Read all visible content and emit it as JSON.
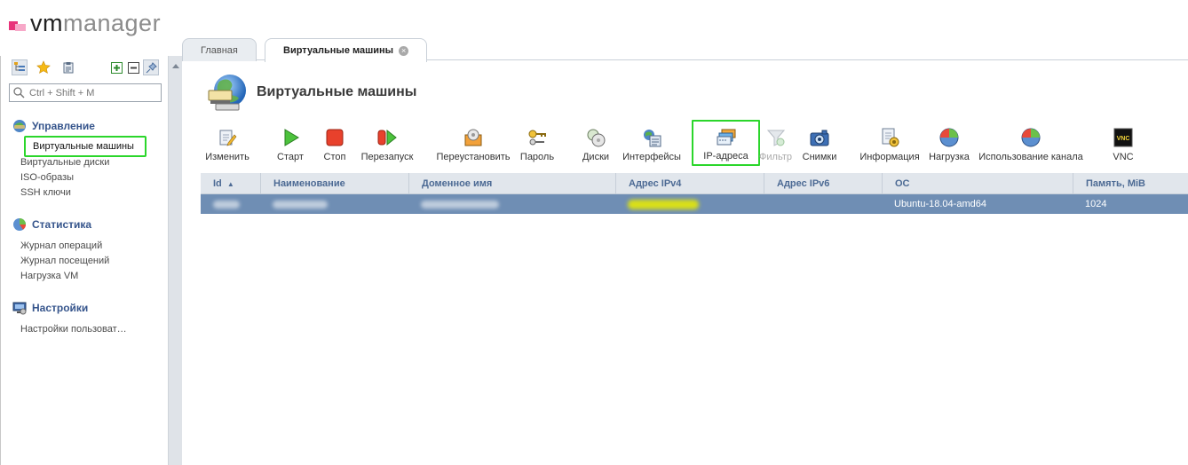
{
  "logo": {
    "part1": "vm",
    "part2": "manager"
  },
  "search": {
    "placeholder": "Ctrl + Shift + M"
  },
  "sidebar": {
    "sections": [
      {
        "title": "Управление",
        "icon": "management-icon",
        "items": [
          "Виртуальные машины",
          "Виртуальные диски",
          "ISO-образы",
          "SSH ключи"
        ]
      },
      {
        "title": "Статистика",
        "icon": "statistics-icon",
        "items": [
          "Журнал операций",
          "Журнал посещений",
          "Нагрузка VM"
        ]
      },
      {
        "title": "Настройки",
        "icon": "settings-icon",
        "items": [
          "Настройки пользоват…"
        ]
      }
    ]
  },
  "tabs": [
    {
      "label": "Главная",
      "active": false
    },
    {
      "label": "Виртуальные машины",
      "active": true
    }
  ],
  "page": {
    "title": "Виртуальные машины"
  },
  "toolbar": {
    "edit": "Изменить",
    "start": "Старт",
    "stop": "Стоп",
    "restart": "Перезапуск",
    "reinstall": "Переустановить",
    "password": "Пароль",
    "disks": "Диски",
    "interfaces": "Интерфейсы",
    "ip": "IP-адреса",
    "filter": "Фильтр",
    "snapshots": "Снимки",
    "info": "Информация",
    "load": "Нагрузка",
    "channel": "Использование канала",
    "vnc": "VNC"
  },
  "grid": {
    "columns": {
      "id": "Id",
      "name": "Наименование",
      "domain": "Доменное имя",
      "ipv4": "Адрес IPv4",
      "ipv6": "Адрес IPv6",
      "os": "ОС",
      "memory": "Память, MiB"
    },
    "sort_indicator": "▲",
    "rows": [
      {
        "os": "Ubuntu-18.04-amd64",
        "memory": "1024"
      }
    ]
  },
  "colors": {
    "highlight": "#2bd62b",
    "selected_row": "#6f8eb4",
    "header_text": "#4c6a94",
    "section_title": "#36558c"
  }
}
